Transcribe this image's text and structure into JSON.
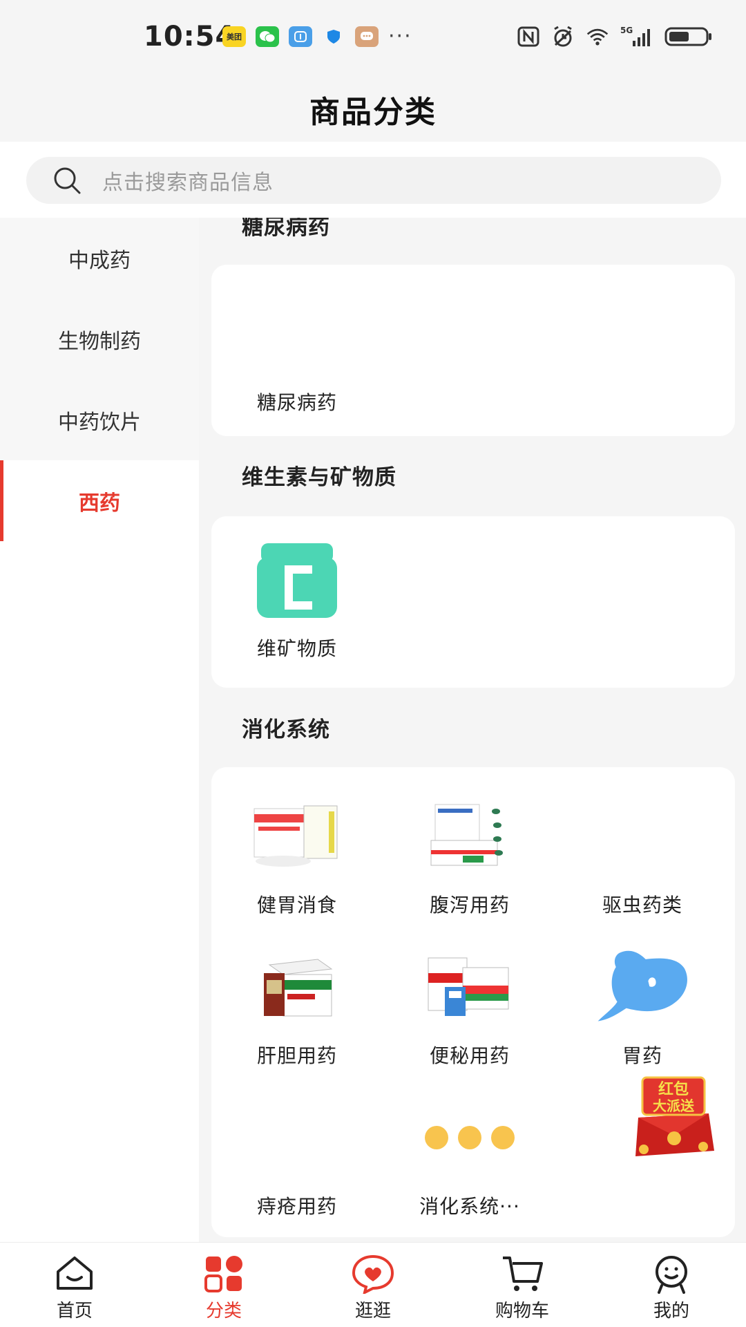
{
  "status_bar": {
    "time": "10:54",
    "notif_meituan": "美团"
  },
  "header": {
    "title": "商品分类"
  },
  "search": {
    "placeholder": "点击搜索商品信息"
  },
  "sidebar": {
    "items": [
      {
        "label": "中成药"
      },
      {
        "label": "生物制药"
      },
      {
        "label": "中药饮片"
      },
      {
        "label": "西药"
      }
    ],
    "active_index": 3
  },
  "content": {
    "sections": [
      {
        "title": "糖尿病药",
        "items": [
          {
            "label": "糖尿病药"
          }
        ]
      },
      {
        "title": "维生素与矿物质",
        "items": [
          {
            "label": "维矿物质"
          }
        ]
      },
      {
        "title": "消化系统",
        "items": [
          {
            "label": "健胃消食"
          },
          {
            "label": "腹泻用药"
          },
          {
            "label": "驱虫药类"
          },
          {
            "label": "肝胆用药"
          },
          {
            "label": "便秘用药"
          },
          {
            "label": "胃药"
          },
          {
            "label": "痔疮用药"
          },
          {
            "label": "消化系统···"
          }
        ]
      }
    ]
  },
  "promo": {
    "line1": "红包",
    "line2": "大派送"
  },
  "bottom_nav": {
    "items": [
      {
        "label": "首页",
        "icon": "home-icon"
      },
      {
        "label": "分类",
        "icon": "category-icon"
      },
      {
        "label": "逛逛",
        "icon": "browse-icon"
      },
      {
        "label": "购物车",
        "icon": "cart-icon"
      },
      {
        "label": "我的",
        "icon": "profile-icon"
      }
    ],
    "active_index": 1
  },
  "colors": {
    "accent": "#e63a2e",
    "teal": "#4cd6b4",
    "stomach_blue": "#5aaaf0",
    "dot_orange": "#f8c44e"
  }
}
